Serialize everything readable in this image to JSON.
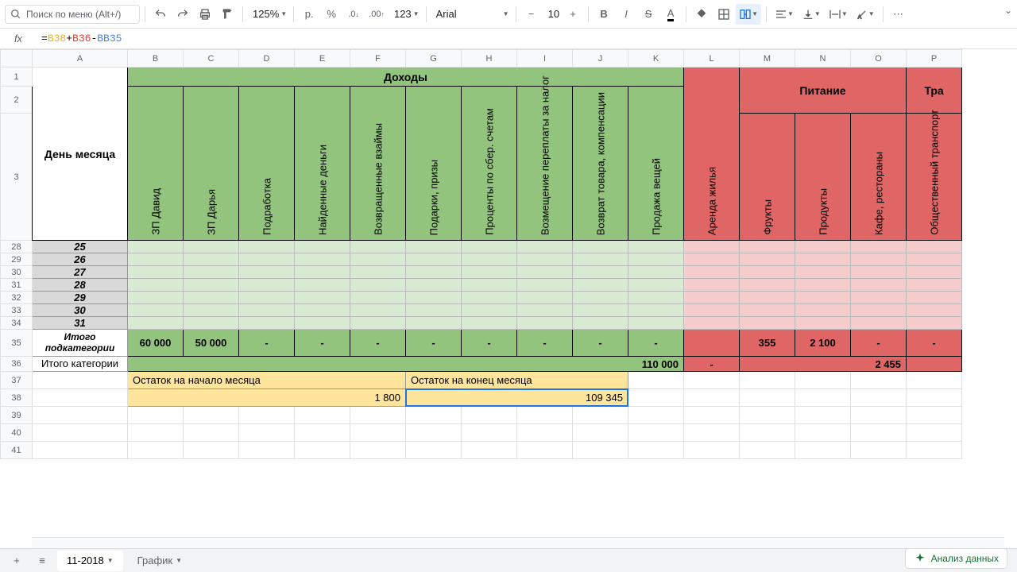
{
  "toolbar": {
    "search_placeholder": "Поиск по меню (Alt+/)",
    "zoom": "125%",
    "currency": "р.",
    "percent": "%",
    "dec_dec": ".0",
    "dec_inc": ".00",
    "num_fmt": "123",
    "font": "Arial",
    "font_size": "10",
    "more": "⋯"
  },
  "formula_bar": {
    "label": "fx",
    "ref1": "B38",
    "plus1": "+",
    "ref2": "B36",
    "minus": "-",
    "ref3": "BB35"
  },
  "columns": [
    "A",
    "B",
    "C",
    "D",
    "E",
    "F",
    "G",
    "H",
    "I",
    "J",
    "K",
    "L",
    "M",
    "N",
    "O",
    "P"
  ],
  "header": {
    "day_label": "День месяца",
    "income": "Доходы",
    "income_cols": [
      "ЗП Давид",
      "ЗП Дарья",
      "Подработка",
      "Найденные деньги",
      "Возвращенные взаймы",
      "Подарки, призы",
      "Проценты по сбер. счетам",
      "Возмещение переплаты за налог",
      "Возврат товара, компенсации",
      "Продажа вещей"
    ],
    "expense_group": "Питание",
    "expense_group2": "Тра",
    "expense_l": "Аренда жилья",
    "expense_cols": [
      "Фрукты",
      "Продукты",
      "Кафе, рестораны"
    ],
    "expense_p": "Общественный транспорт"
  },
  "rows": {
    "day_nums": [
      "28",
      "29",
      "30",
      "31",
      "32",
      "33",
      "34"
    ],
    "days": [
      "25",
      "26",
      "27",
      "28",
      "29",
      "30",
      "31"
    ],
    "subtotal_row": "35",
    "subtotal_label": "Итого подкатегории",
    "subtotal_income": [
      "60 000",
      "50 000",
      "-",
      "-",
      "-",
      "-",
      "-",
      "-",
      "-",
      "-"
    ],
    "subtotal_exp": [
      "",
      "355",
      "2 100",
      "-",
      "-"
    ],
    "cat_row": "36",
    "cat_label": "Итого категории",
    "cat_income": "110 000",
    "cat_exp_l": "-",
    "cat_exp_food": "2 455",
    "r37": "37",
    "start_label": "Остаток на начало месяца",
    "end_label": "Остаток на конец месяца",
    "r38": "38",
    "start_val": "1 800",
    "end_val": "109 345",
    "r39": "39",
    "r40": "40",
    "r41": "41"
  },
  "tabs": {
    "t1": "11-2018",
    "t2": "График"
  },
  "analyze": "Анализ данных"
}
